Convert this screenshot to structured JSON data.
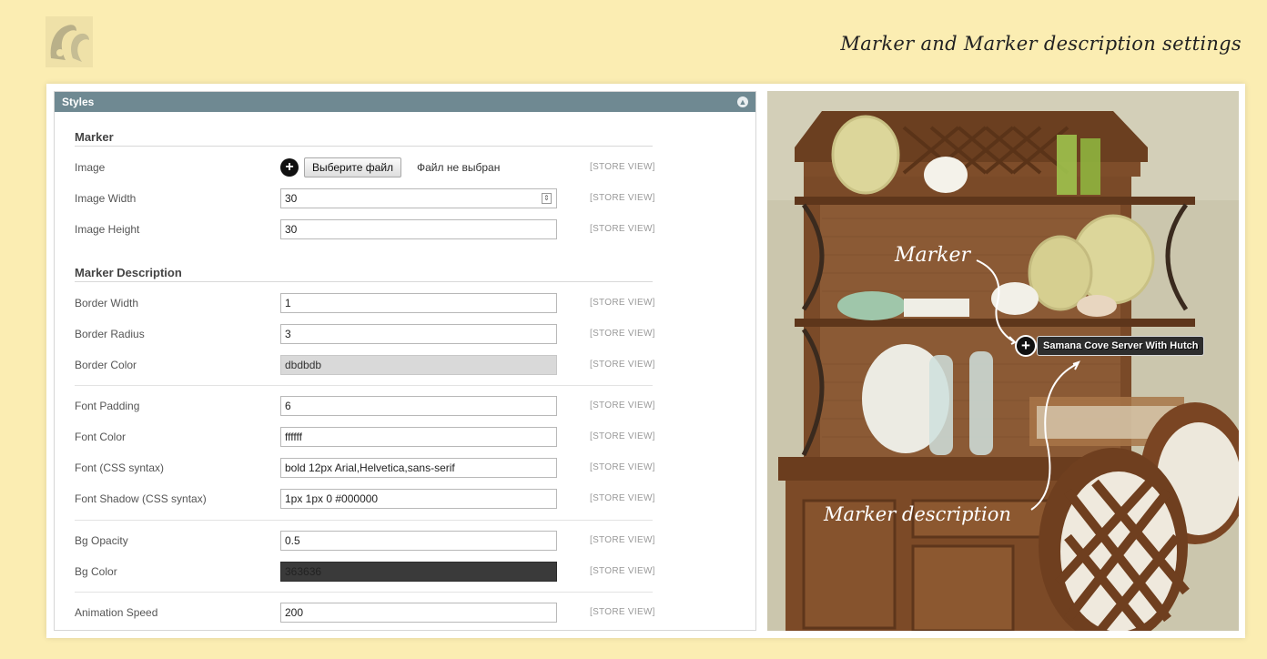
{
  "header": {
    "title": "Marker and Marker description settings"
  },
  "panel": {
    "title": "Styles",
    "scope_label": "[STORE VIEW]",
    "sections": {
      "marker": "Marker",
      "description": "Marker Description"
    },
    "image": {
      "label": "Image",
      "button": "Выберите файл",
      "status": "Файл не выбран"
    },
    "fields": {
      "image_width": {
        "label": "Image Width",
        "value": "30"
      },
      "image_height": {
        "label": "Image Height",
        "value": "30"
      },
      "border_width": {
        "label": "Border Width",
        "value": "1"
      },
      "border_radius": {
        "label": "Border Radius",
        "value": "3"
      },
      "border_color": {
        "label": "Border Color",
        "value": "dbdbdb"
      },
      "font_padding": {
        "label": "Font Padding",
        "value": "6"
      },
      "font_color": {
        "label": "Font Color",
        "value": "ffffff"
      },
      "font_css": {
        "label": "Font (CSS syntax)",
        "value": "bold 12px Arial,Helvetica,sans-serif"
      },
      "font_shadow": {
        "label": "Font Shadow (CSS syntax)",
        "value": "1px 1px 0 #000000"
      },
      "bg_opacity": {
        "label": "Bg Opacity",
        "value": "0.5"
      },
      "bg_color": {
        "label": "Bg Color",
        "value": "363636"
      },
      "animation_speed": {
        "label": "Animation Speed",
        "value": "200"
      }
    }
  },
  "preview": {
    "marker_annotation": "Marker",
    "description_annotation": "Marker description",
    "tooltip_text": "Samana Cove Server With Hutch"
  },
  "colors": {
    "page_background": "#fbedb2",
    "panel_header": "#6f8992",
    "border_color_swatch": "#dbdbdb",
    "bg_color_swatch": "#363636"
  }
}
